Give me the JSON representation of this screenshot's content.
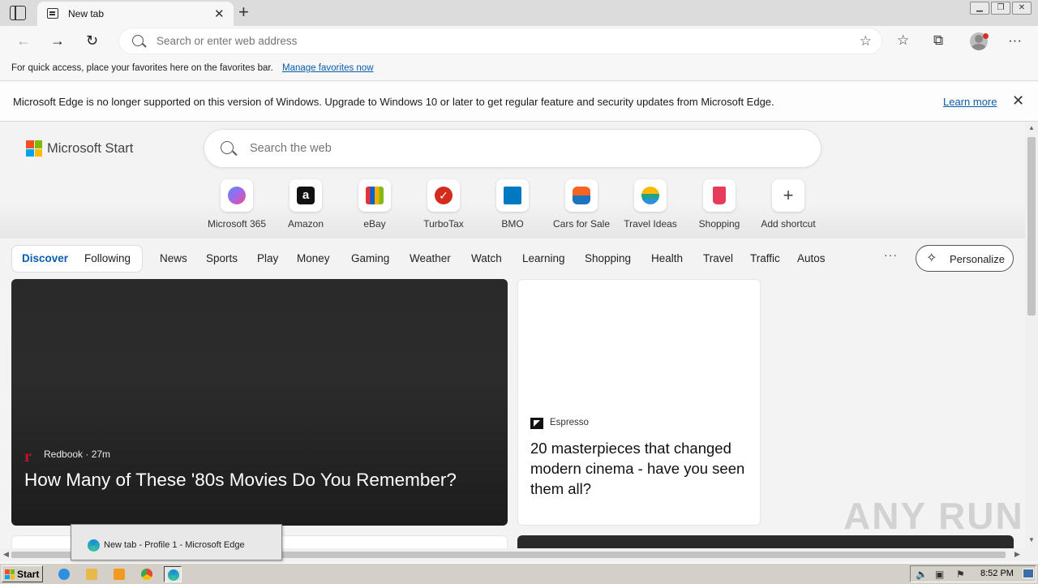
{
  "browser": {
    "tab_title": "New tab",
    "address_placeholder": "Search or enter web address"
  },
  "favorites_bar": {
    "text": "For quick access, place your favorites here on the favorites bar.",
    "link": "Manage favorites now"
  },
  "infobar": {
    "message": "Microsoft Edge is no longer supported on this version of Windows. Upgrade to Windows 10 or later to get regular feature and security updates from Microsoft Edge.",
    "link": "Learn more"
  },
  "start_page": {
    "brand": "Microsoft Start",
    "search_placeholder": "Search the web",
    "shortcuts": [
      {
        "label": "Microsoft 365",
        "color": "#7b5cd6"
      },
      {
        "label": "Amazon",
        "color": "#111111"
      },
      {
        "label": "eBay",
        "color": "#e53238"
      },
      {
        "label": "TurboTax",
        "color": "#d52b1e"
      },
      {
        "label": "BMO",
        "color": "#0079c1"
      },
      {
        "label": "Cars for Sale",
        "color": "#f26522"
      },
      {
        "label": "Travel Ideas",
        "color": "#1fa38a"
      },
      {
        "label": "Shopping",
        "color": "#e63b5a"
      },
      {
        "label": "Add shortcut",
        "color": "#444444"
      }
    ]
  },
  "feed": {
    "tabs": [
      "Discover",
      "Following",
      "News",
      "Sports",
      "Play",
      "Money",
      "Gaming",
      "Weather",
      "Watch",
      "Learning",
      "Shopping",
      "Health",
      "Travel",
      "Traffic",
      "Autos"
    ],
    "more": "···",
    "personalize": "Personalize",
    "main_card": {
      "source": "Redbook · 27m",
      "title": "How Many of These '80s Movies Do You Remember?"
    },
    "side_card": {
      "source": "Espresso",
      "title": "20 masterpieces that changed modern cinema - have you seen them all?"
    }
  },
  "taskbar": {
    "start": "Start",
    "preview": "New tab - Profile 1 - Microsoft Edge",
    "clock": "8:52 PM"
  },
  "watermark": "ANY RUN"
}
